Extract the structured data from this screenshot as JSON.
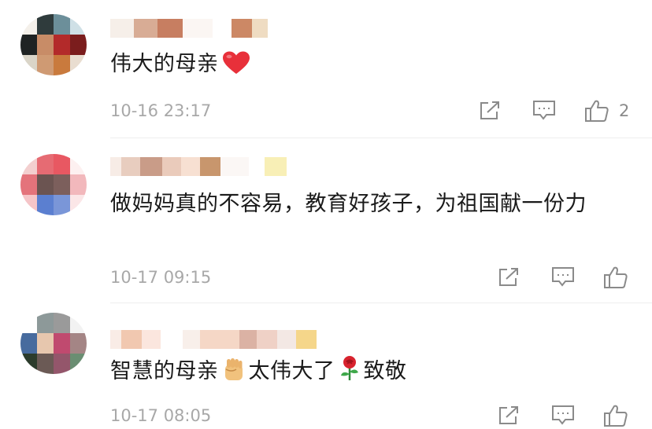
{
  "colors": {
    "text": "#1a1a1a",
    "meta": "#a8a8a8",
    "icon": "#8a8a8a",
    "heart": "#e8303a"
  },
  "icons": {
    "share": "share-icon",
    "comment": "comment-icon",
    "like": "thumbs-up-icon",
    "heart": "red-heart-emoji",
    "fist": "raised-fist-emoji",
    "rose": "rose-emoji"
  },
  "comments": [
    {
      "text_1": "伟大的母亲",
      "time": "10-16 23:17",
      "like_count": "2"
    },
    {
      "text_1": "做妈妈真的不容易，教育好孩子，为祖国献一份力",
      "time": "10-17 09:15",
      "like_count": ""
    },
    {
      "text_1": "智慧的母亲",
      "text_2": "太伟大了",
      "text_3": "致敬",
      "time": "10-17 08:05",
      "like_count": ""
    }
  ]
}
